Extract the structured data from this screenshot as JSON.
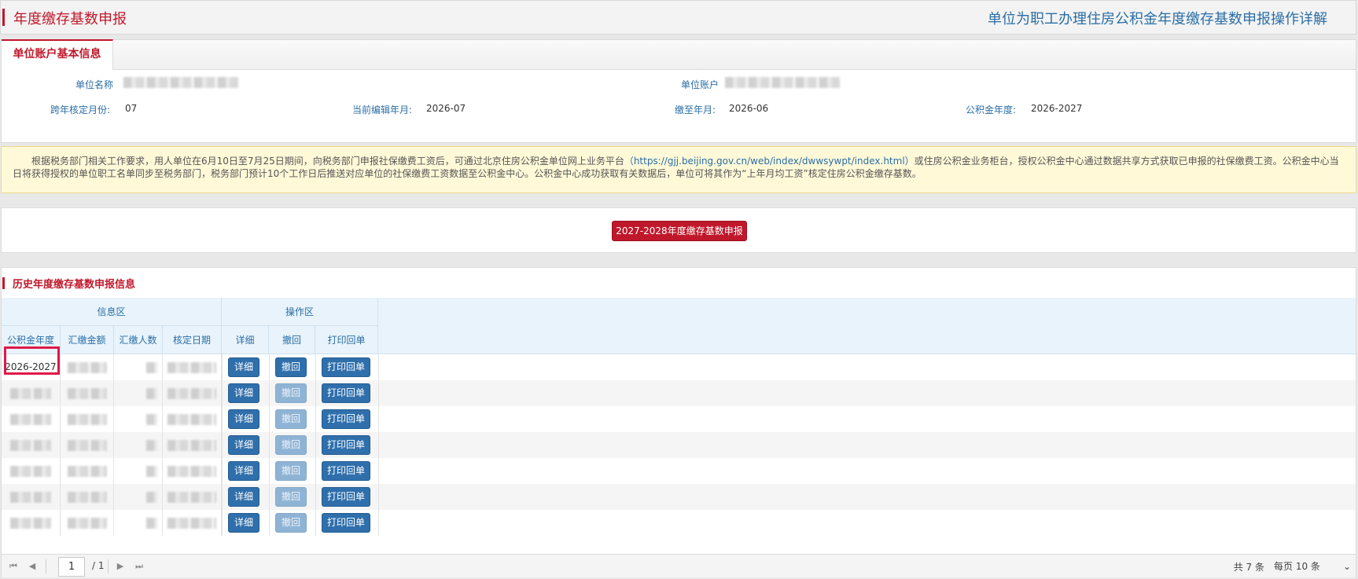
{
  "header": {
    "title": "年度缴存基数申报",
    "guide_link": "单位为职工办理住房公积金年度缴存基数申报操作详解"
  },
  "info_panel": {
    "tab_label": "单位账户基本信息",
    "fields": {
      "unit_name_label": "单位名称",
      "unit_account_label": "单位账户",
      "cross_year_month_label": "跨年核定月份:",
      "cross_year_month_value": "07",
      "current_edit_label": "当前编辑年月:",
      "current_edit_value": "2026-07",
      "paid_until_label": "缴至年月:",
      "paid_until_value": "2026-06",
      "fund_year_label": "公积金年度:",
      "fund_year_value": "2026-2027"
    }
  },
  "notice": {
    "text_before": "根据税务部门相关工作要求，用人单位在6月10日至7月25日期间，向税务部门申报社保缴费工资后，可通过北京住房公积金单位网上业务平台",
    "link": "（https://gjj.beijing.gov.cn/web/index/dwwsywpt/index.html）",
    "text_after": "或住房公积金业务柜台，授权公积金中心通过数据共享方式获取已申报的社保缴费工资。公积金中心当日将获得授权的单位职工名单同步至税务部门，税务部门预计10个工作日后推送对应单位的社保缴费工资数据至公积金中心。公积金中心成功获取有关数据后，单位可将其作为“上年月均工资”核定住房公积金缴存基数。"
  },
  "apply": {
    "button_label": "2027-2028年度缴存基数申报"
  },
  "history": {
    "title": "历史年度缴存基数申报信息",
    "group_headers": {
      "info": "信息区",
      "ops": "操作区"
    },
    "columns": {
      "fund_year": "公积金年度",
      "amount": "汇缴金额",
      "people": "汇缴人数",
      "verify_date": "核定日期",
      "detail": "详细",
      "revoke": "撤回",
      "print": "打印回单"
    },
    "rows": [
      {
        "fund_year": "2026-2027",
        "detail": "详细",
        "revoke": "撤回",
        "print": "打印回单",
        "revoke_enabled": true
      },
      {
        "fund_year": "",
        "detail": "详细",
        "revoke": "撤回",
        "print": "打印回单",
        "revoke_enabled": false
      },
      {
        "fund_year": "",
        "detail": "详细",
        "revoke": "撤回",
        "print": "打印回单",
        "revoke_enabled": false
      },
      {
        "fund_year": "",
        "detail": "详细",
        "revoke": "撤回",
        "print": "打印回单",
        "revoke_enabled": false
      },
      {
        "fund_year": "",
        "detail": "详细",
        "revoke": "撤回",
        "print": "打印回单",
        "revoke_enabled": false
      },
      {
        "fund_year": "",
        "detail": "详细",
        "revoke": "撤回",
        "print": "打印回单",
        "revoke_enabled": false
      },
      {
        "fund_year": "",
        "detail": "详细",
        "revoke": "撤回",
        "print": "打印回单",
        "revoke_enabled": false
      }
    ]
  },
  "pager": {
    "current_page": "1",
    "total_pages": "/ 1",
    "total_count": "共 7 条",
    "page_size": "每页  10  条"
  },
  "colors": {
    "brand_red": "#c0182b",
    "link_blue": "#2a6ea6",
    "button_blue": "#2f6fab",
    "highlight_pink": "#e0194a"
  }
}
